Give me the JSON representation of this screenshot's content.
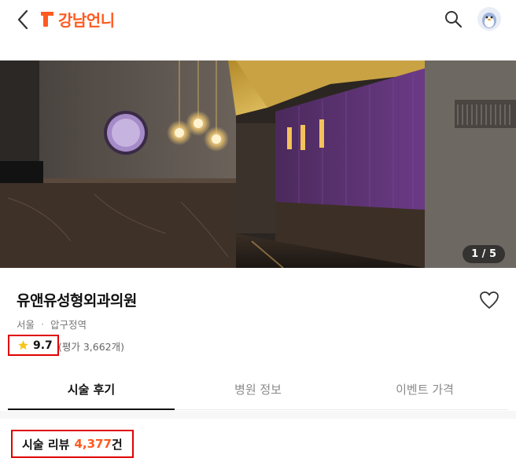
{
  "header": {
    "logo_text": "강남언니",
    "brand_color": "#ff5a1f",
    "back_icon": "chevron-left-icon",
    "search_icon": "search-icon",
    "avatar_icon": "penguin-avatar-icon"
  },
  "hero": {
    "page_indicator": "1 / 5",
    "current_page": 1,
    "total_pages": 5
  },
  "clinic": {
    "name": "유앤유성형외과의원",
    "city": "서울",
    "separator": "·",
    "district": "압구정역",
    "rating": "9.7",
    "rating_count_text": "(평가 3,662개)",
    "star_color": "#f5c518"
  },
  "tabs": [
    {
      "label": "시술 후기",
      "active": true
    },
    {
      "label": "병원 정보",
      "active": false
    },
    {
      "label": "이벤트 가격",
      "active": false
    }
  ],
  "reviews": {
    "label": "시술 리뷰",
    "count": "4,377",
    "unit": "건"
  },
  "highlight_color": "#e00000"
}
